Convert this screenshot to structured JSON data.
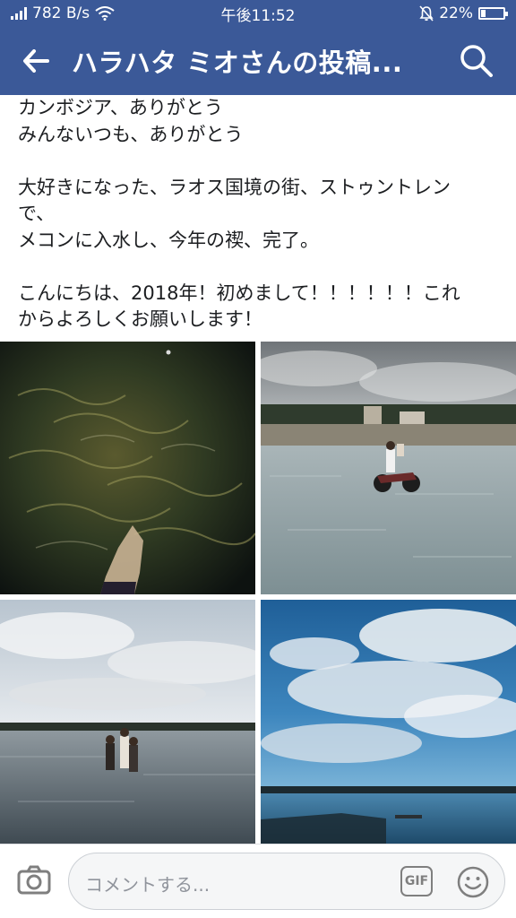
{
  "status_bar": {
    "data_rate": "782 B/s",
    "time": "午後11:52",
    "battery": "22%",
    "battery_level": 0.22
  },
  "nav": {
    "title": "ハラハタ ミオさんの投稿..."
  },
  "post": {
    "paragraphs": [
      [
        "カンボジア、ありがとう",
        "みんないつも、ありがとう"
      ],
      [
        "大好きになった、ラオス国境の街、ストゥントレン",
        "で、",
        "メコンに入水し、今年の禊、完了。"
      ],
      [
        "こんにちは、2018年！初めまして！！！！！！これ",
        "からよろしくお願いします！"
      ]
    ]
  },
  "photos": [
    {
      "name": "photo-night-water-foot"
    },
    {
      "name": "photo-motorbike-river"
    },
    {
      "name": "photo-people-in-river"
    },
    {
      "name": "photo-blue-sky-river"
    }
  ],
  "comment_bar": {
    "placeholder": "コメントする...",
    "gif_label": "GIF"
  },
  "colors": {
    "brand": "#3b5998",
    "text": "#1c1e21",
    "muted": "#90949c"
  },
  "icons": {
    "back": "arrow-left-icon",
    "search": "search-icon",
    "camera": "camera-icon",
    "emoji": "smiley-icon",
    "wifi": "wifi-icon",
    "signal": "signal-icon",
    "mute": "bell-off-icon",
    "battery": "battery-icon"
  }
}
